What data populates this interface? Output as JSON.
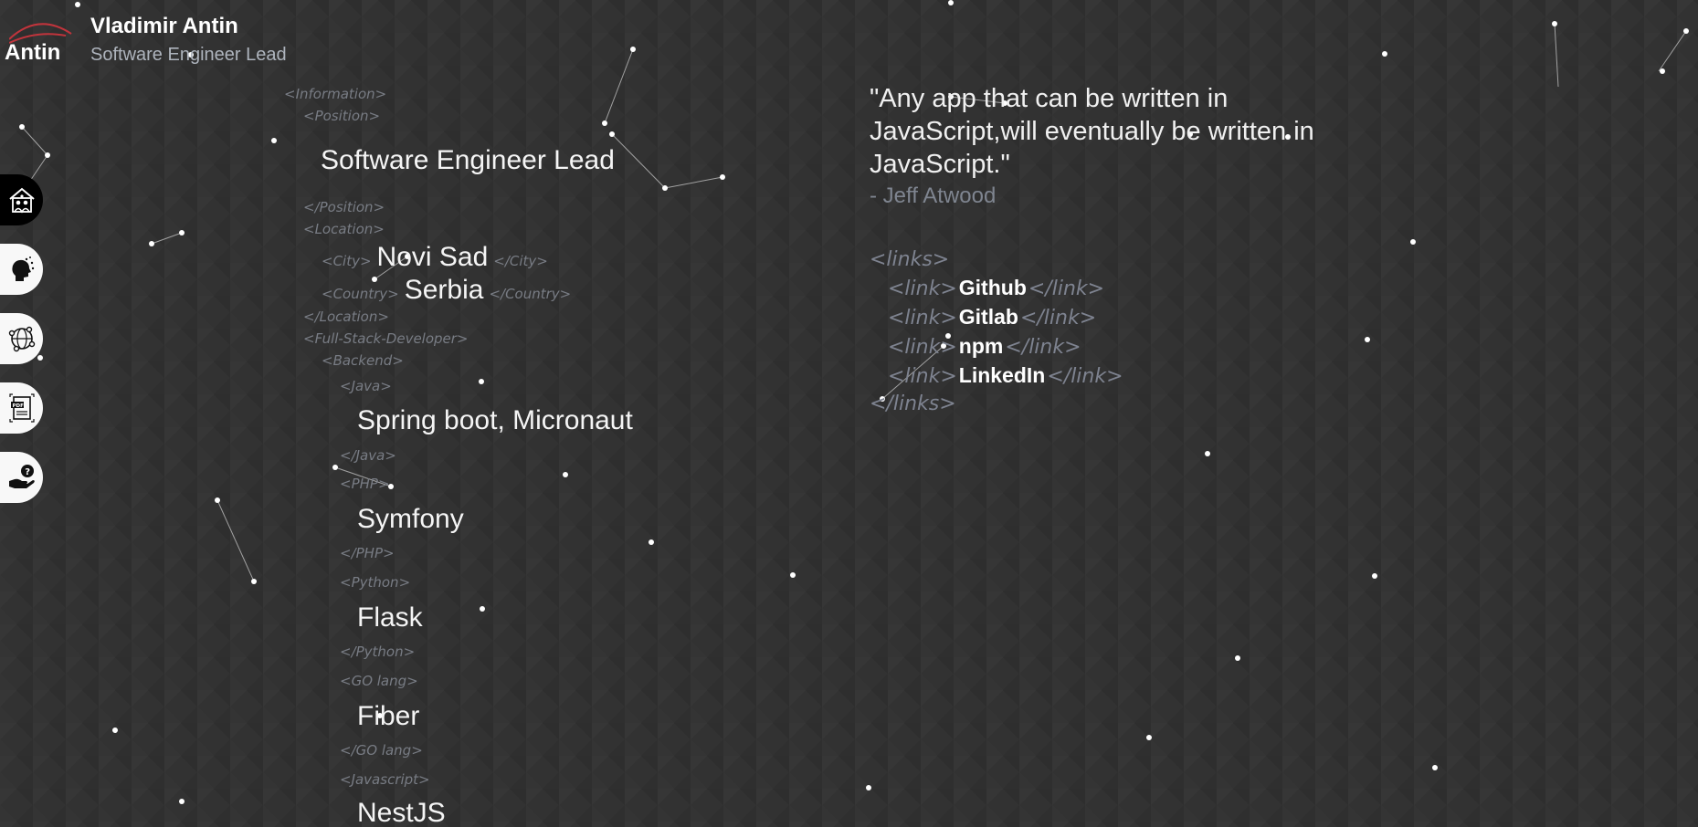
{
  "header": {
    "logo_text": "Antin",
    "name": "Vladimir Antin",
    "title": "Software Engineer Lead"
  },
  "sidebar": {
    "items": [
      {
        "name": "home",
        "icon": "house-people-icon",
        "active": true
      },
      {
        "name": "about",
        "icon": "head-ideas-icon",
        "active": false
      },
      {
        "name": "projects",
        "icon": "globe-network-icon",
        "active": false
      },
      {
        "name": "resume",
        "icon": "pdf-document-icon",
        "active": false
      },
      {
        "name": "contact",
        "icon": "hand-question-icon",
        "active": false
      }
    ]
  },
  "info": {
    "open_information": "<Information>",
    "open_position": "<Position>",
    "position_value": "Software Engineer Lead",
    "close_position": "</Position>",
    "open_location": "<Location>",
    "open_city": "<City>",
    "city_value": "Novi Sad",
    "close_city": "</City>",
    "open_country": "<Country>",
    "country_value": "Serbia",
    "close_country": "</Country>",
    "close_location": "</Location>",
    "open_fullstack": "<Full-Stack-Developer>",
    "open_backend": "<Backend>",
    "open_java": "<Java>",
    "java_value": "Spring boot, Micronaut",
    "close_java": "</Java>",
    "open_php": "<PHP>",
    "php_value": "Symfony",
    "close_php": "</PHP>",
    "open_python": "<Python>",
    "python_value": "Flask",
    "close_python": "</Python>",
    "open_go": "<GO lang>",
    "go_value": "Fiber",
    "close_go": "</GO lang>",
    "open_js": "<Javascript>",
    "js_value": "NestJS"
  },
  "quote": {
    "text": "\"Any app that can be written in JavaScript,will eventually be written in JavaScript.\"",
    "author": "- Jeff Atwood"
  },
  "links": {
    "open_tag": "<links>",
    "close_tag": "</links>",
    "link_open": "<link>",
    "link_close": "</link>",
    "items": [
      "Github",
      "Gitlab",
      "npm",
      "LinkedIn"
    ]
  },
  "colors": {
    "background": "#343434",
    "tag_gray": "#787c84",
    "brand_red": "#c0343c",
    "text_white": "#ffffff"
  }
}
